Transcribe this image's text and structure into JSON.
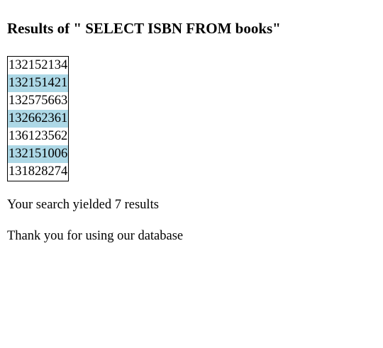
{
  "page": {
    "title": "Results of \" SELECT ISBN FROM books\""
  },
  "results": {
    "rows": [
      {
        "isbn": "132152134"
      },
      {
        "isbn": "132151421"
      },
      {
        "isbn": "132575663"
      },
      {
        "isbn": "132662361"
      },
      {
        "isbn": "136123562"
      },
      {
        "isbn": "132151006"
      },
      {
        "isbn": "131828274"
      }
    ],
    "alt_row_color": "#add8e6"
  },
  "summary": {
    "count_text": "Your search yielded 7 results",
    "thanks_text": "Thank you for using our database"
  }
}
